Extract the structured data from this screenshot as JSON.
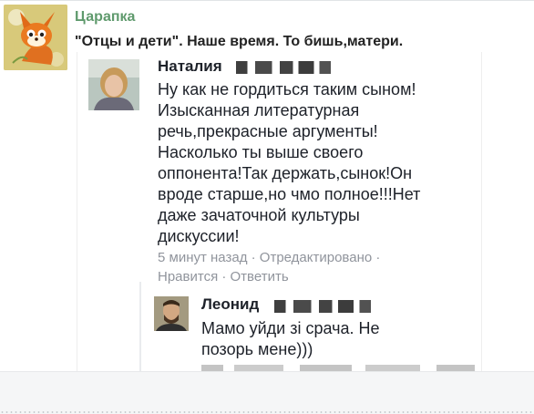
{
  "post": {
    "author": "Царапка",
    "title": "\"Отцы и дети\". Наше время. То бишь,матери.",
    "avatar_icon": "fox-cartoon-avatar"
  },
  "screenshot": {
    "comment": {
      "name": "Наталия",
      "lines": [
        "Ну как не гордиться таким сыном!",
        "Изысканная литературная",
        "речь,прекрасные аргументы!",
        "Насколько ты выше своего",
        "оппонента!Так держать,сынок!Он",
        "вроде старше,но чмо полное!!!Нет",
        "даже зачаточной культуры",
        "дискуссии!"
      ],
      "meta_time": "5 минут назад · Отредактировано ·",
      "meta_actions": "Нравится · Ответить"
    },
    "reply": {
      "name": "Леонид",
      "lines": [
        "Мамо уйди зі срача. Не",
        "позорь мене)))"
      ]
    }
  },
  "colors": {
    "author_name": "#5f9a6d",
    "meta_text": "#90949c",
    "body_text": "#1d2129"
  }
}
